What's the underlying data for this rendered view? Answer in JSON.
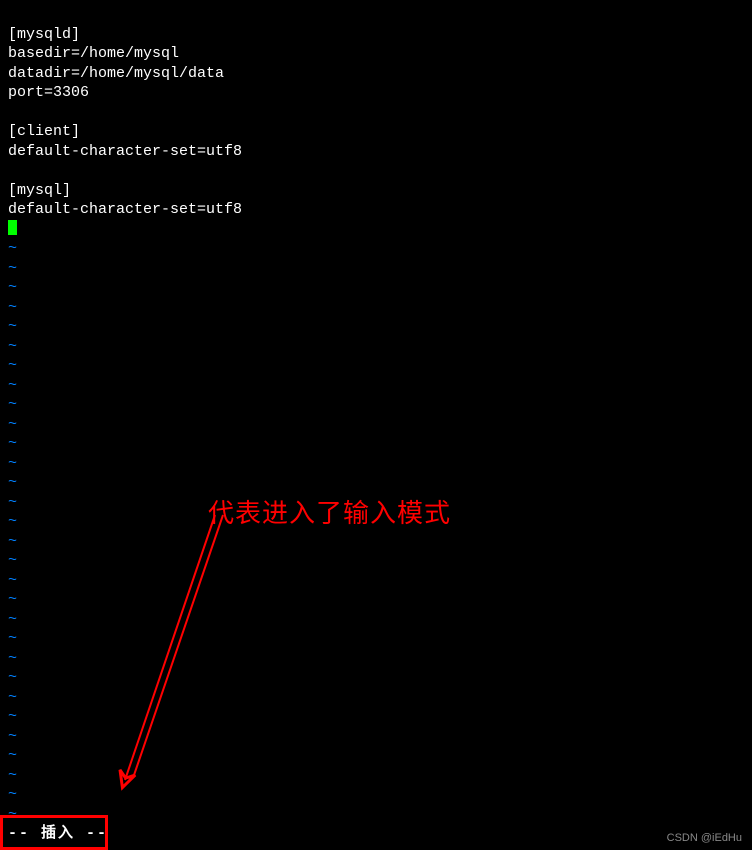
{
  "config": {
    "section_mysqld": "[mysqld]",
    "basedir": "basedir=/home/mysql",
    "datadir": "datadir=/home/mysql/data",
    "port": "port=3306",
    "section_client": "[client]",
    "client_charset": "default-character-set=utf8",
    "section_mysql": "[mysql]",
    "mysql_charset": "default-character-set=utf8"
  },
  "vim": {
    "tilde": "~",
    "insert_mode_text": "-- 插入 --"
  },
  "annotation": {
    "text": "代表进入了输入模式"
  },
  "watermark": {
    "text": "CSDN @iEdHu"
  }
}
